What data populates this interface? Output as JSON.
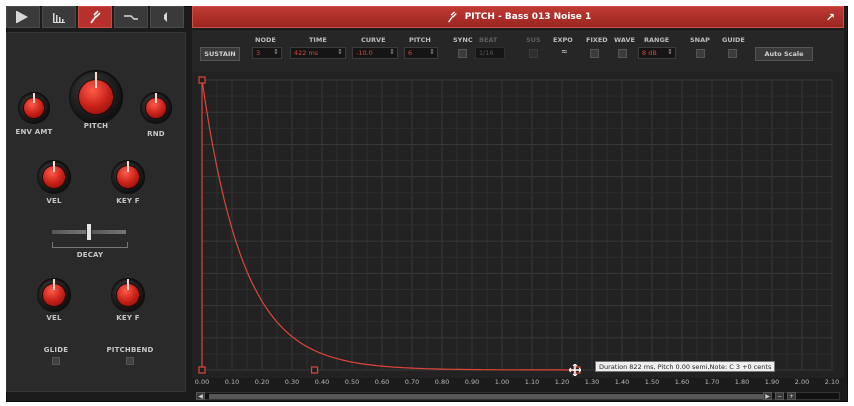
{
  "tabs": [
    {
      "icon": "play-icon"
    },
    {
      "icon": "bars-icon"
    },
    {
      "icon": "tuning-fork-icon",
      "active": true
    },
    {
      "icon": "envelope-curve-icon"
    },
    {
      "icon": "speaker-icon"
    }
  ],
  "left_panel": {
    "knobs": {
      "env_amt": "ENV AMT",
      "pitch": "PITCH",
      "rnd": "RND",
      "vel": "VEL",
      "key_f": "KEY F",
      "vel2": "VEL",
      "key_f2": "KEY F"
    },
    "decay_label": "DECAY",
    "glide_label": "GLIDE",
    "pitchbend_label": "PITCHBEND"
  },
  "header": {
    "icon": "tuning-fork-icon",
    "title": "PITCH - Bass 013 Noise 1",
    "pin_icon": "pin-icon"
  },
  "toolbar": {
    "sustain": "SUSTAIN",
    "node_label": "NODE",
    "node_value": "3",
    "time_label": "TIME",
    "time_value": "422 ms",
    "curve_label": "CURVE",
    "curve_value": "-10.0",
    "pitch_label": "PITCH",
    "pitch_value": "6",
    "sync_label": "SYNC",
    "beat_label": "BEAT",
    "beat_value": "1/16",
    "sus_label": "SUS",
    "expo_label": "EXPO",
    "expo_value": "≈",
    "fixed_label": "FIXED",
    "wave_label": "WAVE",
    "range_label": "RANGE",
    "range_value": "8 dB",
    "snap_label": "SNAP",
    "guide_label": "GUIDE",
    "auto_scale": "Auto Scale"
  },
  "graph": {
    "x_ticks": [
      "0.00",
      "0.10",
      "0.20",
      "0.30",
      "0.40",
      "0.50",
      "0.60",
      "0.70",
      "0.80",
      "0.90",
      "1.00",
      "1.10",
      "1.20",
      "1.30",
      "1.40",
      "1.50",
      "1.60",
      "1.70",
      "1.80",
      "1.90",
      "2.00",
      "2.10"
    ],
    "tooltip": "Duration 822 ms, Pitch 0.00 semi,Note: C 3 +0 cents",
    "envelope_color": "#e0453a"
  },
  "colors": {
    "accent": "#b8302c",
    "knob_red": "#d2231a",
    "envelope": "#e0453a"
  }
}
